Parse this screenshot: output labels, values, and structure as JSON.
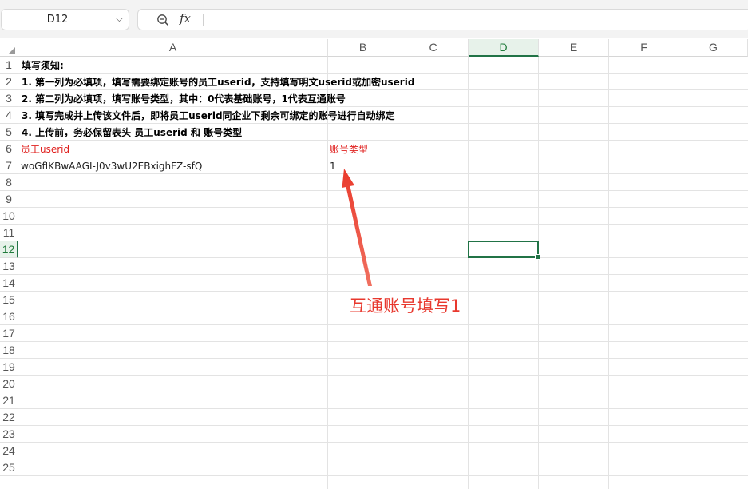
{
  "formula_bar": {
    "cell_ref": "D12",
    "formula": "",
    "fx_label": "fx"
  },
  "columns": [
    "A",
    "B",
    "C",
    "D",
    "E",
    "F",
    "G"
  ],
  "active_column": "D",
  "rows": [
    "1",
    "2",
    "3",
    "4",
    "5",
    "6",
    "7",
    "8",
    "9",
    "10",
    "11",
    "12",
    "13",
    "14",
    "15",
    "16",
    "17",
    "18",
    "19",
    "20",
    "21",
    "22",
    "23",
    "24",
    "25"
  ],
  "active_row": "12",
  "cells": {
    "A1": "填写须知:",
    "A2": "1. 第一列为必填项，填写需要绑定账号的员工userid，支持填写明文userid或加密userid",
    "A3": "2. 第二列为必填项，填写账号类型，其中：0代表基础账号，1代表互通账号",
    "A4": "3. 填写完成并上传该文件后，即将员工userid同企业下剩余可绑定的账号进行自动绑定",
    "A5": "4. 上传前，务必保留表头 员工userid 和 账号类型",
    "A6": "员工userid",
    "B6": "账号类型",
    "A7": "woGfIKBwAAGI-J0v3wU2EBxighFZ-sfQ",
    "B7": "1"
  },
  "annotation": {
    "text": "互通账号填写1",
    "color": "#e8382e"
  },
  "colors": {
    "accent": "#217346",
    "header_red": "#e0201e"
  }
}
